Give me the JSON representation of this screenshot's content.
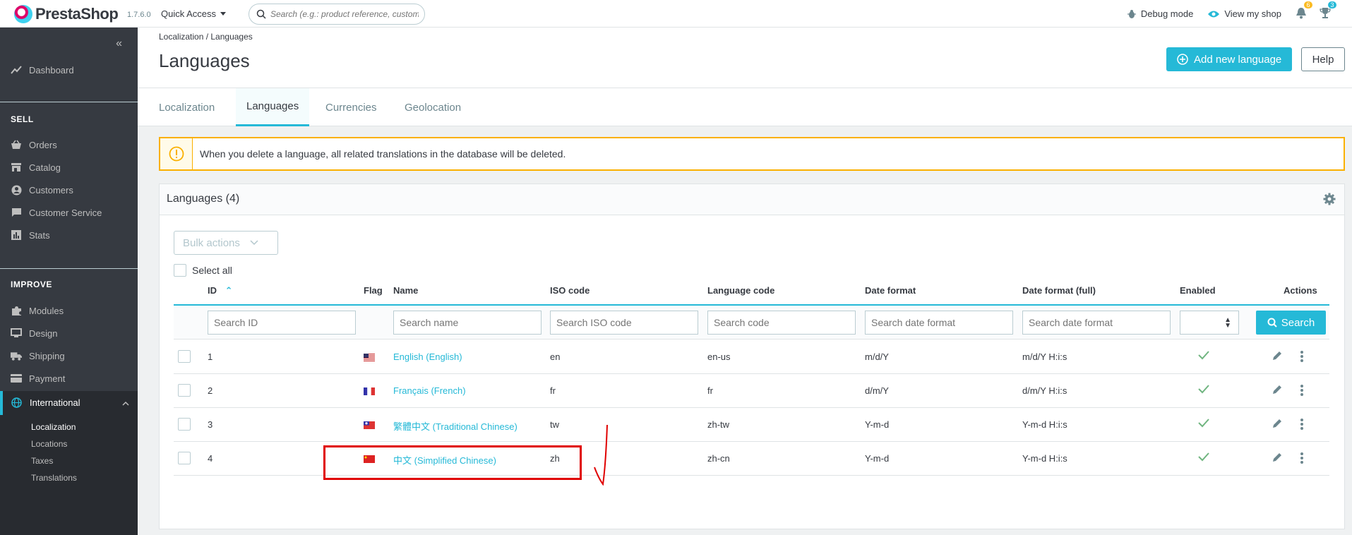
{
  "header": {
    "brand": "PrestaShop",
    "version": "1.7.6.0",
    "quick_access": "Quick Access",
    "search_placeholder": "Search (e.g.: product reference, customer name...)",
    "debug_mode": "Debug mode",
    "view_shop": "View my shop",
    "notifications_count": "6",
    "trophy_count": "3"
  },
  "sidebar": {
    "dashboard": "Dashboard",
    "sell_title": "SELL",
    "orders": "Orders",
    "catalog": "Catalog",
    "customers": "Customers",
    "customer_service": "Customer Service",
    "stats": "Stats",
    "improve_title": "IMPROVE",
    "modules": "Modules",
    "design": "Design",
    "shipping": "Shipping",
    "payment": "Payment",
    "international": "International",
    "sub_items": [
      "Localization",
      "Locations",
      "Taxes",
      "Translations"
    ]
  },
  "page": {
    "breadcrumb": "Localization  /  Languages",
    "title": "Languages",
    "add_button": "Add new language",
    "help_button": "Help",
    "tabs": [
      "Localization",
      "Languages",
      "Currencies",
      "Geolocation"
    ],
    "alert": "When you delete a language, all related translations in the database will be deleted."
  },
  "table": {
    "card_title": "Languages (4)",
    "bulk_actions": "Bulk actions",
    "select_all": "Select all",
    "headers": {
      "id": "ID",
      "flag": "Flag",
      "name": "Name",
      "iso": "ISO code",
      "lang_code": "Language code",
      "date_format": "Date format",
      "date_format_full": "Date format (full)",
      "enabled": "Enabled",
      "actions": "Actions"
    },
    "filters": {
      "id": "Search ID",
      "name": "Search name",
      "iso": "Search ISO code",
      "code": "Search code",
      "date": "Search date format",
      "date_full": "Search date format",
      "search_button": "Search"
    },
    "rows": [
      {
        "id": "1",
        "name": "English (English)",
        "iso": "en",
        "code": "en-us",
        "date": "m/d/Y",
        "date_full": "m/d/Y H:i:s",
        "flag": "us"
      },
      {
        "id": "2",
        "name": "Français (French)",
        "iso": "fr",
        "code": "fr",
        "date": "d/m/Y",
        "date_full": "d/m/Y H:i:s",
        "flag": "fr"
      },
      {
        "id": "3",
        "name": "繁體中文 (Traditional Chinese)",
        "iso": "tw",
        "code": "zh-tw",
        "date": "Y-m-d",
        "date_full": "Y-m-d H:i:s",
        "flag": "tw"
      },
      {
        "id": "4",
        "name": "中文 (Simplified Chinese)",
        "iso": "zh",
        "code": "zh-cn",
        "date": "Y-m-d",
        "date_full": "Y-m-d H:i:s",
        "flag": "cn"
      }
    ]
  },
  "colors": {
    "accent": "#25b9d7",
    "sidebar": "#363a41",
    "warning": "#fab000",
    "success": "#70b580",
    "annotation": "#e00000"
  }
}
